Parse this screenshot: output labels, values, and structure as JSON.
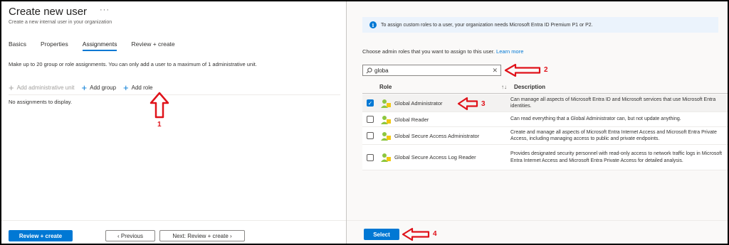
{
  "header": {
    "title": "Create new user",
    "more": "···",
    "subtitle": "Create a new internal user in your organization"
  },
  "tabs": [
    {
      "label": "Basics"
    },
    {
      "label": "Properties"
    },
    {
      "label": "Assignments",
      "active": true
    },
    {
      "label": "Review + create"
    }
  ],
  "assignments": {
    "info": "Make up to 20 group or role assignments. You can only add a user to a maximum of 1 administrative unit.",
    "commands": {
      "add_admin_unit": "Add administrative unit",
      "add_group": "Add group",
      "add_role": "Add role"
    },
    "empty_text": "No assignments to display."
  },
  "footer": {
    "review_create": "Review + create",
    "previous": "‹ Previous",
    "next": "Next: Review + create ›"
  },
  "role_panel": {
    "banner": "To assign custom roles to a user, your organization needs Microsoft Entra ID Premium P1 or P2.",
    "choose_text": "Choose admin roles that you want to assign to this user.",
    "learn_more": "Learn more",
    "search_value": "globa",
    "columns": {
      "role": "Role",
      "sort": "↑↓",
      "description": "Description"
    },
    "rows": [
      {
        "name": "Global Administrator",
        "checked": true,
        "description": "Can manage all aspects of Microsoft Entra ID and Microsoft services that use Microsoft Entra identities."
      },
      {
        "name": "Global Reader",
        "checked": false,
        "description": "Can read everything that a Global Administrator can, but not update anything."
      },
      {
        "name": "Global Secure Access Administrator",
        "checked": false,
        "description": "Create and manage all aspects of Microsoft Entra Internet Access and Microsoft Entra Private Access, including managing access to public and private endpoints."
      },
      {
        "name": "Global Secure Access Log Reader",
        "checked": false,
        "description": "Provides designated security personnel with read-only access to network traffic logs in Microsoft Entra Internet Access and Microsoft Entra Private Access for detailed analysis."
      }
    ],
    "select_button": "Select"
  },
  "annotations": {
    "n1": "1",
    "n2": "2",
    "n3": "3",
    "n4": "4"
  },
  "colors": {
    "accent": "#0078d4",
    "annotation": "#e0121a"
  },
  "icons": [
    "info-icon",
    "search-icon",
    "clear-icon",
    "role-icon",
    "plus-icon",
    "arrow-annotation-icon"
  ]
}
